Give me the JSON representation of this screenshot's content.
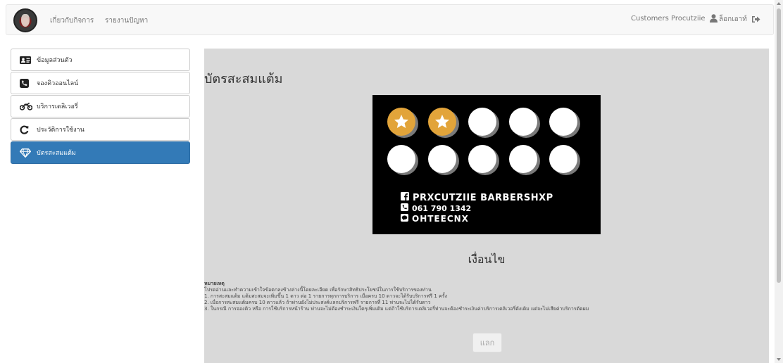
{
  "navbar": {
    "about_label": "เกี่ยวกับกิจการ",
    "report_label": "รายงานปัญหา",
    "user_label": "Customers Procutziie",
    "logout_label": "ล็อกเอาท์"
  },
  "sidebar": {
    "items": [
      {
        "label": "ข้อมูลส่วนตัว",
        "icon": "id-card-icon"
      },
      {
        "label": "จองคิวออนไลน์",
        "icon": "phone-icon"
      },
      {
        "label": "บริการเดลิเวอรี่",
        "icon": "motorcycle-icon"
      },
      {
        "label": "ประวัติการใช้งาน",
        "icon": "history-icon"
      },
      {
        "label": "บัตรสะสมแต้ม",
        "icon": "diamond-icon",
        "active": true
      }
    ]
  },
  "main": {
    "title": "บัตรสะสมแต้ม",
    "card": {
      "stamps_total": 10,
      "stamps_filled": 2,
      "shop_name": "PRXCUTZIIE BARBERSHXP",
      "phone": "061 790 1342",
      "line_id": "OHTEECNX"
    },
    "conditions_title": "เงื่อนไข",
    "notes": {
      "heading": "หมายเหตุ",
      "intro": "โปรดอ่านและทำความเข้าใจข้อตกลงข้างล่างนี้โดยละเอียด เพื่อรักษาสิทธิประโยชน์ในการใช้บริการของท่าน",
      "item1": "1. การสะสมแต้ม แต้มสะสมจะเพิ่มขึ้น 1 ดาว ต่อ 1 รายการทุกการบริการ เมื่อครบ 10 ดาวจะได้รับบริการฟรี 1 ครั้ง",
      "item2": "2. เมื่อการสะสมแต้มครบ 10 ดาวแล้ว ถ้าท่านยังไม่ประสงค์แลกบริการฟรี รายการที่ 11 ท่านจะไม่ได้รับดาว",
      "item3": "3. ในกรณี การจองคิว หรือ การใช้บริการหน้าร้าน ท่านจะไม่ต้องชำระเงินใดๆเพิ่มเติม แต่ถ้าใช้บริการเดลิเวอรี่ท่านจะต้องชำระเงินค่าบริการเดลิเวอรี่ดังเดิม แต่จะไม่เสียค่าบริการตัดผม"
    },
    "redeem_label": "แลก"
  },
  "colors": {
    "accent": "#337ab7",
    "stamp_filled": "#e2a43a",
    "panel_bg": "#d9d9d9"
  }
}
